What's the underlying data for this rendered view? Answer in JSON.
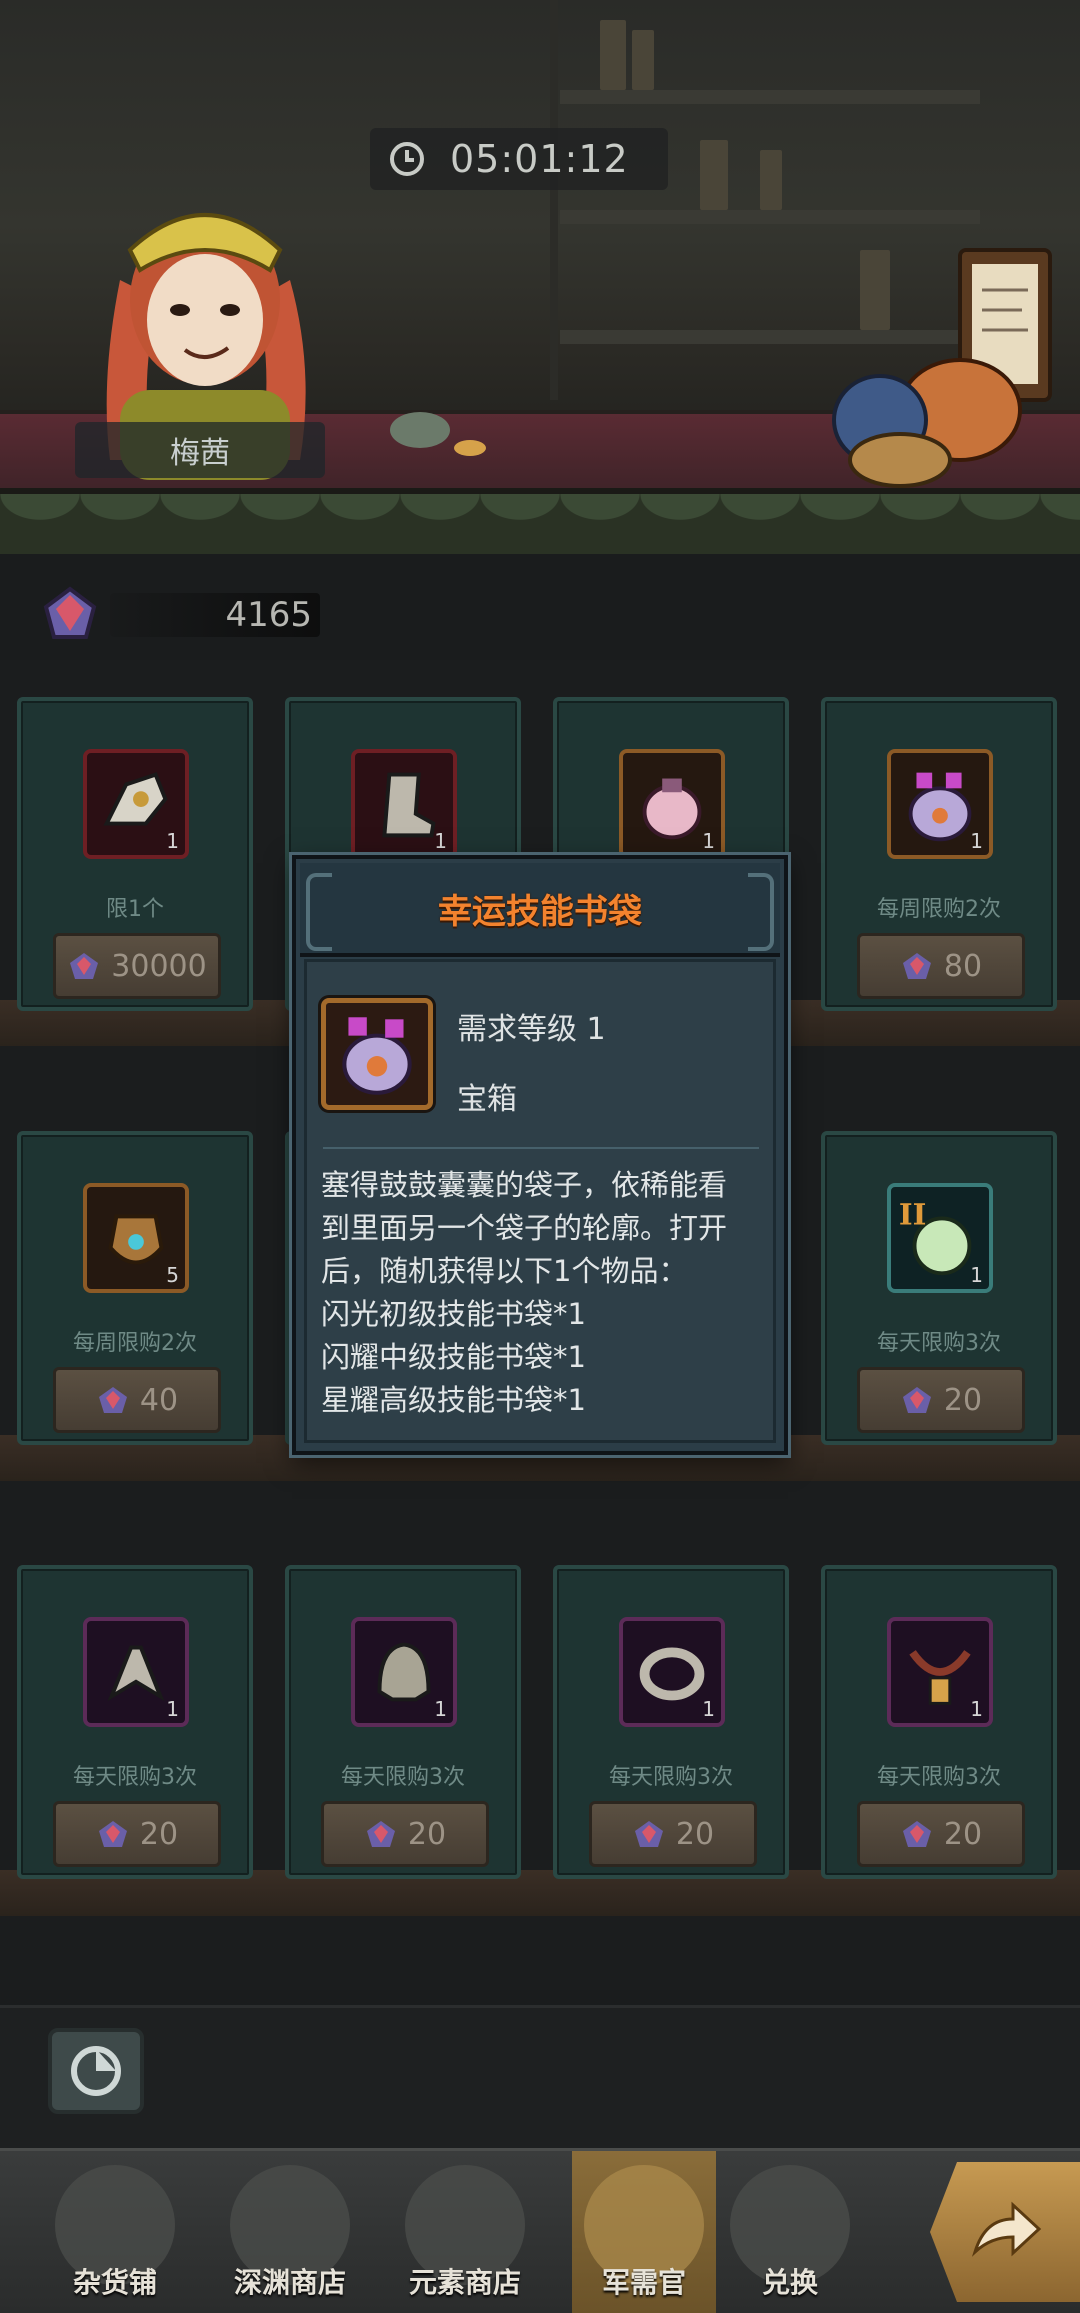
{
  "header": {
    "timer_value": "05:01:12",
    "npc_name": "梅茜"
  },
  "currency": {
    "amount": "4165"
  },
  "shop_items": [
    {
      "count": "1",
      "limit": "限1个",
      "price": "30000",
      "icon": "glove-icon"
    },
    {
      "count": "1",
      "limit": "",
      "price": "",
      "icon": "boot-icon"
    },
    {
      "count": "1",
      "limit": "",
      "price": "",
      "icon": "pink-pouch-icon"
    },
    {
      "count": "1",
      "limit": "每周限购2次",
      "price": "80",
      "icon": "skill-bag-icon"
    },
    {
      "count": "5",
      "limit": "每周限购2次",
      "price": "40",
      "icon": "urn-icon"
    },
    {
      "count": "1",
      "limit": "每天限购3次",
      "price": "20",
      "icon": "green-orb-icon"
    },
    {
      "count": "1",
      "limit": "每天限购3次",
      "price": "20",
      "icon": "claw-icon"
    },
    {
      "count": "1",
      "limit": "每天限购3次",
      "price": "20",
      "icon": "helmet-icon"
    },
    {
      "count": "1",
      "limit": "每天限购3次",
      "price": "20",
      "icon": "ring-icon"
    },
    {
      "count": "1",
      "limit": "每天限购3次",
      "price": "20",
      "icon": "necklace-icon"
    }
  ],
  "popup": {
    "title": "幸运技能书袋",
    "level_req": "需求等级 1",
    "item_type": "宝箱",
    "description_lines": [
      "塞得鼓鼓囊囊的袋子，依稀能看",
      "到里面另一个袋子的轮廓。打开",
      "后，随机获得以下1个物品：",
      "闪光初级技能书袋*1",
      "闪耀中级技能书袋*1",
      "星耀高级技能书袋*1"
    ]
  },
  "nav": [
    {
      "label": "杂货铺"
    },
    {
      "label": "深渊商店"
    },
    {
      "label": "元素商店"
    },
    {
      "label": "军需官",
      "active": true
    },
    {
      "label": "兑换"
    }
  ],
  "colors": {
    "popup_title": "#f3832e",
    "card_bg": "#1e3432",
    "popup_bg": "#2b3d47"
  }
}
